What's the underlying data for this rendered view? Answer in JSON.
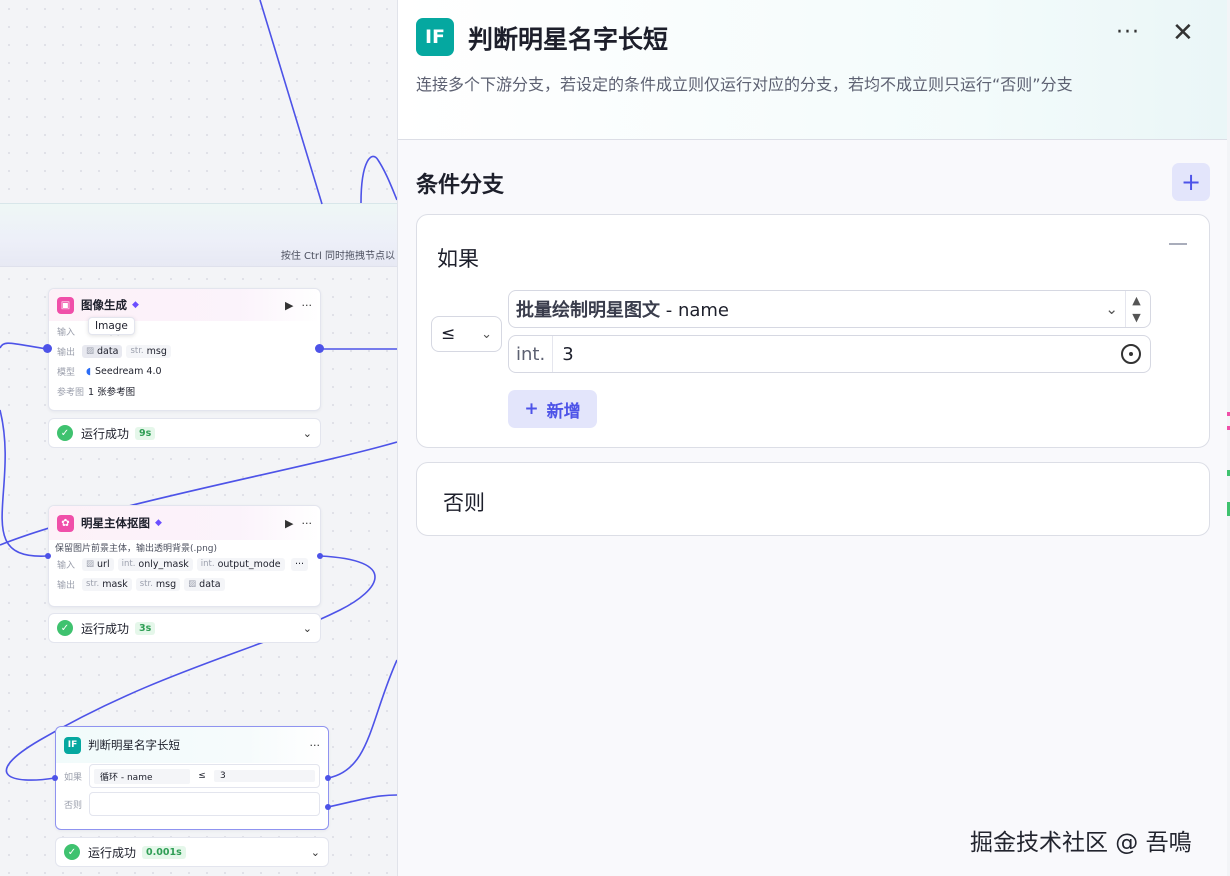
{
  "canvas": {
    "hint": "按住 Ctrl 同时拖拽节点以",
    "tooltip": "Image",
    "nodes": {
      "image_gen": {
        "title": "图像生成",
        "input_label": "输入",
        "input_tail": "入",
        "output_label": "输出",
        "outputs": [
          {
            "type": "",
            "name": "data"
          },
          {
            "type": "str.",
            "name": "msg"
          }
        ],
        "model_label": "模型",
        "model_value": "Seedream 4.0",
        "ref_label": "参考图",
        "ref_value": "1 张参考图",
        "status": "运行成功",
        "time": "9s"
      },
      "matting": {
        "title": "明星主体抠图",
        "desc": "保留图片前景主体，输出透明背景(.png)",
        "input_label": "输入",
        "inputs": [
          {
            "type": "",
            "name": "url"
          },
          {
            "type": "int.",
            "name": "only_mask"
          },
          {
            "type": "int.",
            "name": "output_mode"
          }
        ],
        "output_label": "输出",
        "outputs": [
          {
            "type": "str.",
            "name": "mask"
          },
          {
            "type": "str.",
            "name": "msg"
          },
          {
            "type": "",
            "name": "data"
          }
        ],
        "status": "运行成功",
        "time": "3s"
      },
      "condition": {
        "title": "判断明星名字长短",
        "if_label": "如果",
        "if_left": "循环 - name",
        "if_op": "≤",
        "if_right": "3",
        "else_label": "否则",
        "status": "运行成功",
        "time": "0.001s"
      }
    }
  },
  "panel": {
    "icon_text": "IF",
    "title": "判断明星名字长短",
    "description": "连接多个下游分支，若设定的条件成立则仅运行对应的分支，若均不成立则只运行“否则”分支",
    "section_title": "条件分支",
    "if_label": "如果",
    "operator": "≤",
    "variable_node": "批量绘制明星图文",
    "variable_sep": " - ",
    "variable_name": "name",
    "value_type": "int.",
    "value": "3",
    "add_label": "新增",
    "else_label": "否则"
  },
  "watermark": "掘金技术社区 @ 吾鳴",
  "colors": {
    "accent": "#4d53e8",
    "if_icon": "#05a8a0",
    "success": "#3fc26f"
  }
}
